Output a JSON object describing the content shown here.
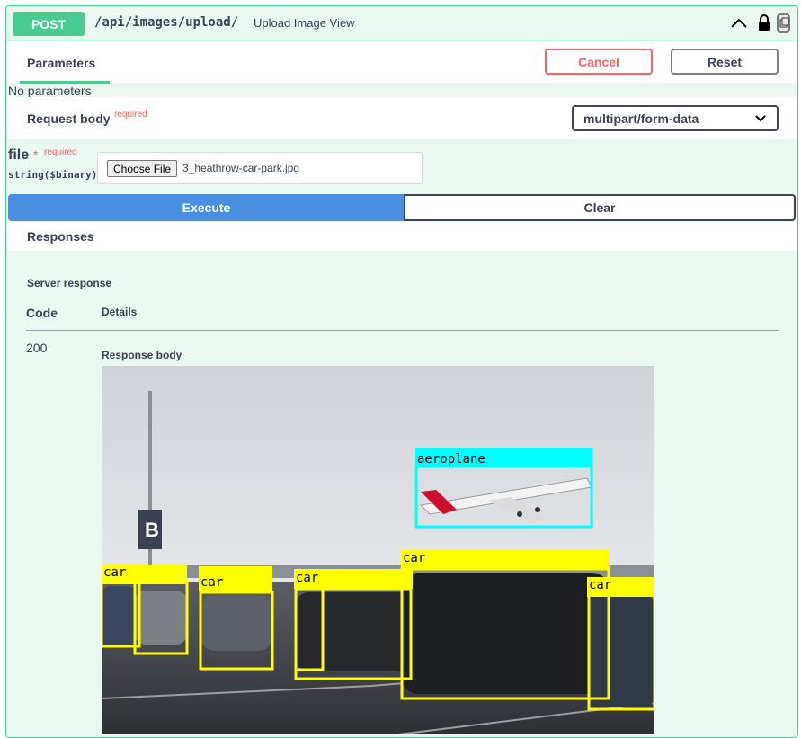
{
  "endpoint": {
    "method": "POST",
    "path": "/api/images/upload/",
    "description": "Upload Image View"
  },
  "parameters": {
    "tab_label": "Parameters",
    "cancel_label": "Cancel",
    "reset_label": "Reset",
    "empty_text": "No parameters"
  },
  "request_body": {
    "label": "Request body",
    "required_text": "required",
    "content_type": "multipart/form-data"
  },
  "file_param": {
    "name": "file",
    "required_star": "*",
    "required_text": "required",
    "type": "string($binary)",
    "choose_label": "Choose File",
    "chosen_file": "3_heathrow-car-park.jpg"
  },
  "actions": {
    "execute_label": "Execute",
    "clear_label": "Clear"
  },
  "responses": {
    "title": "Responses",
    "server_response_label": "Server response",
    "code_header": "Code",
    "details_header": "Details",
    "code": "200",
    "response_body_label": "Response body",
    "detections": [
      {
        "label": "aeroplane"
      },
      {
        "label": "car"
      },
      {
        "label": "car"
      },
      {
        "label": "car"
      },
      {
        "label": "car"
      },
      {
        "label": "car"
      }
    ]
  },
  "colors": {
    "post_green": "#49cc90",
    "execute_blue": "#4990e2",
    "cancel_red": "#ff6060",
    "detect_yellow": "#ffff00",
    "detect_cyan": "#00ffff"
  }
}
